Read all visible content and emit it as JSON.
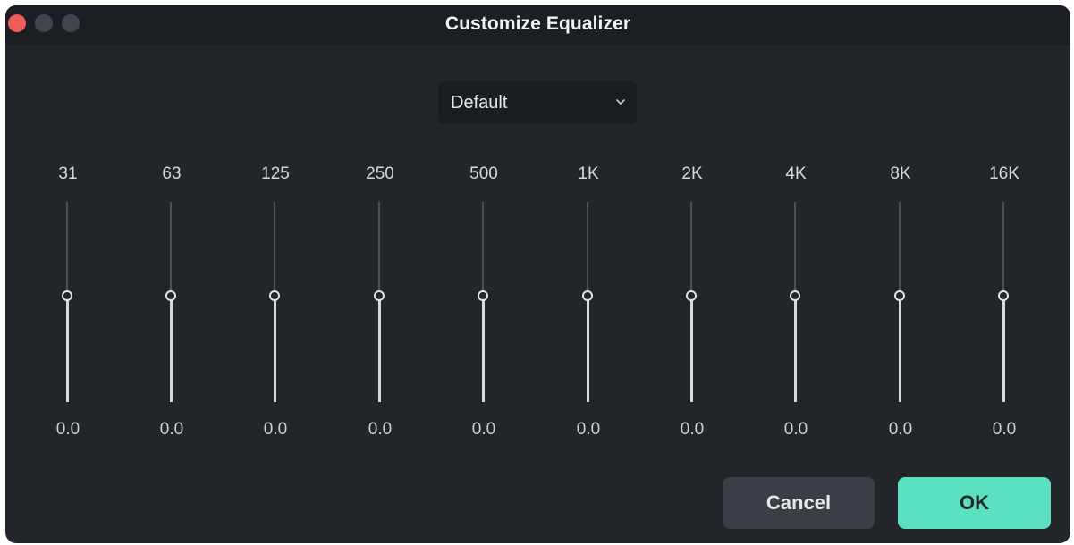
{
  "window": {
    "title": "Customize Equalizer"
  },
  "preset": {
    "selected": "Default",
    "icon": "chevron-down-icon"
  },
  "bands": [
    {
      "freq": "31",
      "gain": "0.0",
      "level": 0.0
    },
    {
      "freq": "63",
      "gain": "0.0",
      "level": 0.0
    },
    {
      "freq": "125",
      "gain": "0.0",
      "level": 0.0
    },
    {
      "freq": "250",
      "gain": "0.0",
      "level": 0.0
    },
    {
      "freq": "500",
      "gain": "0.0",
      "level": 0.0
    },
    {
      "freq": "1K",
      "gain": "0.0",
      "level": 0.0
    },
    {
      "freq": "2K",
      "gain": "0.0",
      "level": 0.0
    },
    {
      "freq": "4K",
      "gain": "0.0",
      "level": 0.0
    },
    {
      "freq": "8K",
      "gain": "0.0",
      "level": 0.0
    },
    {
      "freq": "16K",
      "gain": "0.0",
      "level": 0.0
    }
  ],
  "actions": {
    "cancel_label": "Cancel",
    "ok_label": "OK"
  },
  "colors": {
    "accent": "#5ce1c0",
    "window_bg": "#22262b",
    "close": "#ee5e57"
  }
}
